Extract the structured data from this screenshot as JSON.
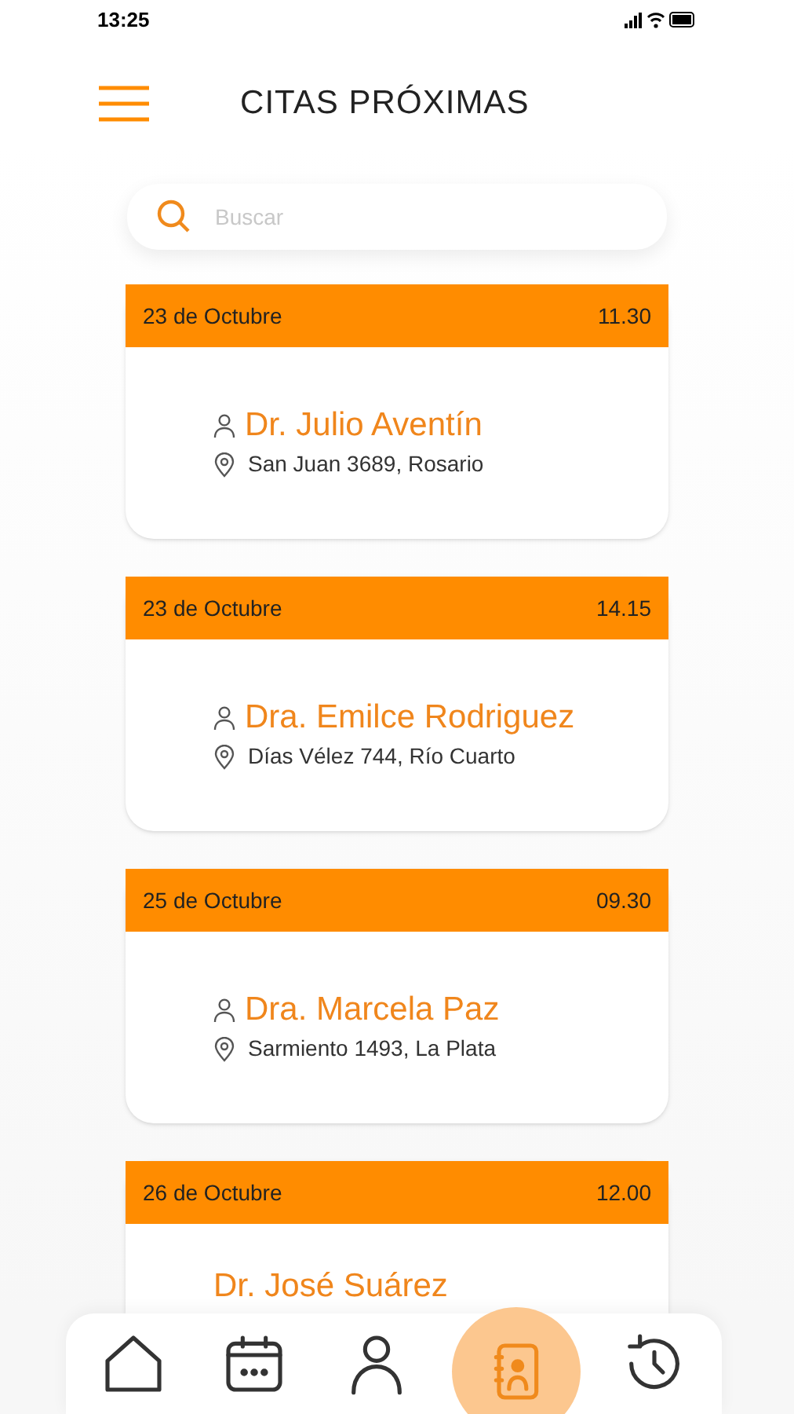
{
  "status_bar": {
    "time": "13:25"
  },
  "header": {
    "title": "CITAS PRÓXIMAS"
  },
  "search": {
    "placeholder": "Buscar"
  },
  "appointments": [
    {
      "date": "23 de Octubre",
      "time": "11.30",
      "doctor": "Dr. Julio Aventín",
      "address": "San Juan 3689, Rosario"
    },
    {
      "date": "23 de Octubre",
      "time": "14.15",
      "doctor": "Dra. Emilce Rodriguez",
      "address": "Días Vélez 744, Río Cuarto"
    },
    {
      "date": "25 de Octubre",
      "time": "09.30",
      "doctor": "Dra. Marcela Paz",
      "address": "Sarmiento 1493, La Plata"
    },
    {
      "date": "26 de Octubre",
      "time": "12.00",
      "doctor": "Dr. José Suárez"
    }
  ],
  "nav": [
    {
      "kind": "home",
      "selected": false
    },
    {
      "kind": "calendar",
      "selected": false
    },
    {
      "kind": "profile",
      "selected": false
    },
    {
      "kind": "contacts",
      "selected": true
    },
    {
      "kind": "history",
      "selected": false
    }
  ]
}
